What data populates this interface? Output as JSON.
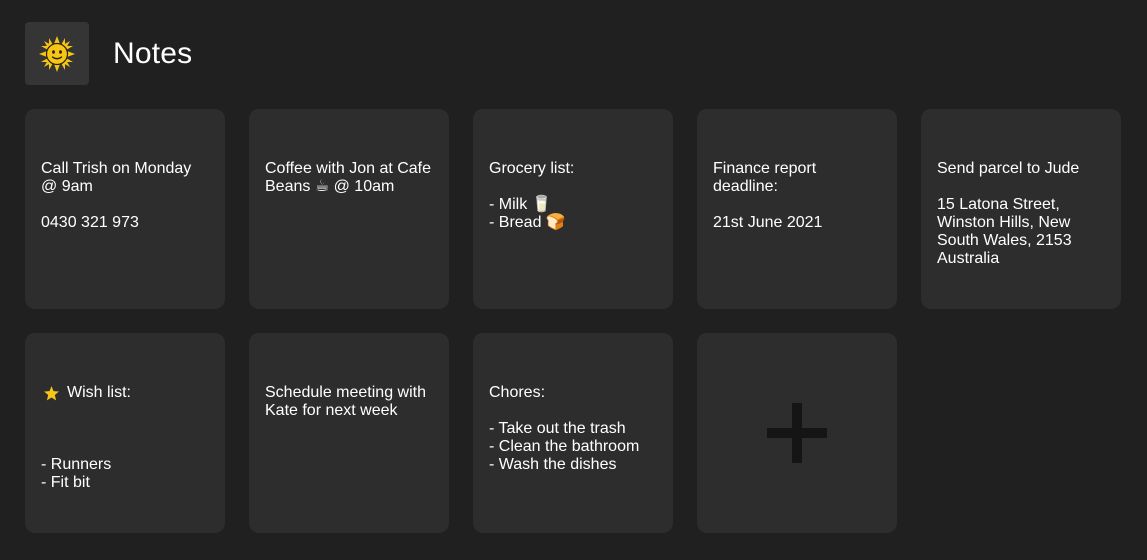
{
  "header": {
    "title": "Notes",
    "logo_icon": "sun-icon"
  },
  "notes": [
    {
      "text": "Call Trish on Monday @ 9am\n\n0430 321 973"
    },
    {
      "text": "Coffee with Jon at Cafe Beans ☕ @ 10am"
    },
    {
      "text": "Grocery list:\n\n- Milk 🥛\n- Bread 🍞"
    },
    {
      "text": "Finance report deadline:\n\n21st June 2021"
    },
    {
      "text": "Send parcel to Jude\n\n15 Latona Street, Winston Hills, New South Wales, 2153 Australia"
    },
    {
      "icon": "star-icon",
      "title": "Wish list:",
      "text": "- Runners\n- Fit bit"
    },
    {
      "text": "Schedule meeting with Kate for next week"
    },
    {
      "text": "Chores:\n\n- Take out the trash\n- Clean the bathroom\n- Wash the dishes"
    }
  ],
  "add_note": {
    "icon": "plus-icon"
  },
  "colors": {
    "background": "#202020",
    "card": "#2d2d2d",
    "logo_tile": "#353535",
    "plus": "#151515",
    "star": "#f5c518",
    "sun": "#f5c518"
  }
}
